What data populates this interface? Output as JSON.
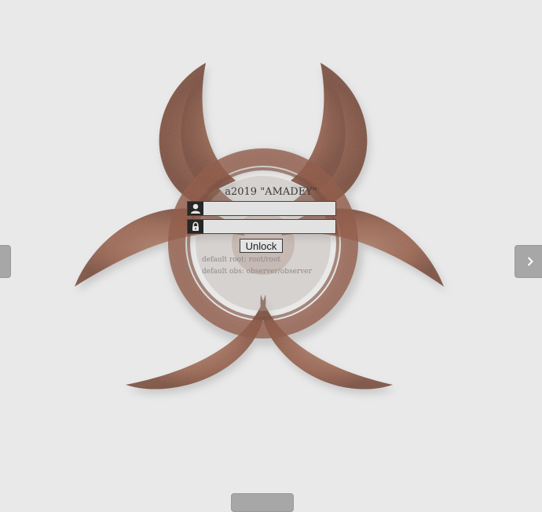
{
  "login": {
    "title": "a2019 \"AMADEY\"",
    "username_value": "",
    "password_value": "",
    "unlock_label": "Unlock",
    "hint_root": "default root: root/root",
    "hint_obs": "default obs: observer/observer"
  },
  "icons": {
    "background": "biohazard-symbol",
    "username": "user-icon",
    "password": "lock-icon",
    "next": "chevron-right-icon"
  },
  "colors": {
    "background": "#e9e9e9",
    "emblem": "#8c4a36",
    "field_icon_bg": "#262626",
    "nav_button": "#a7a7a7"
  }
}
